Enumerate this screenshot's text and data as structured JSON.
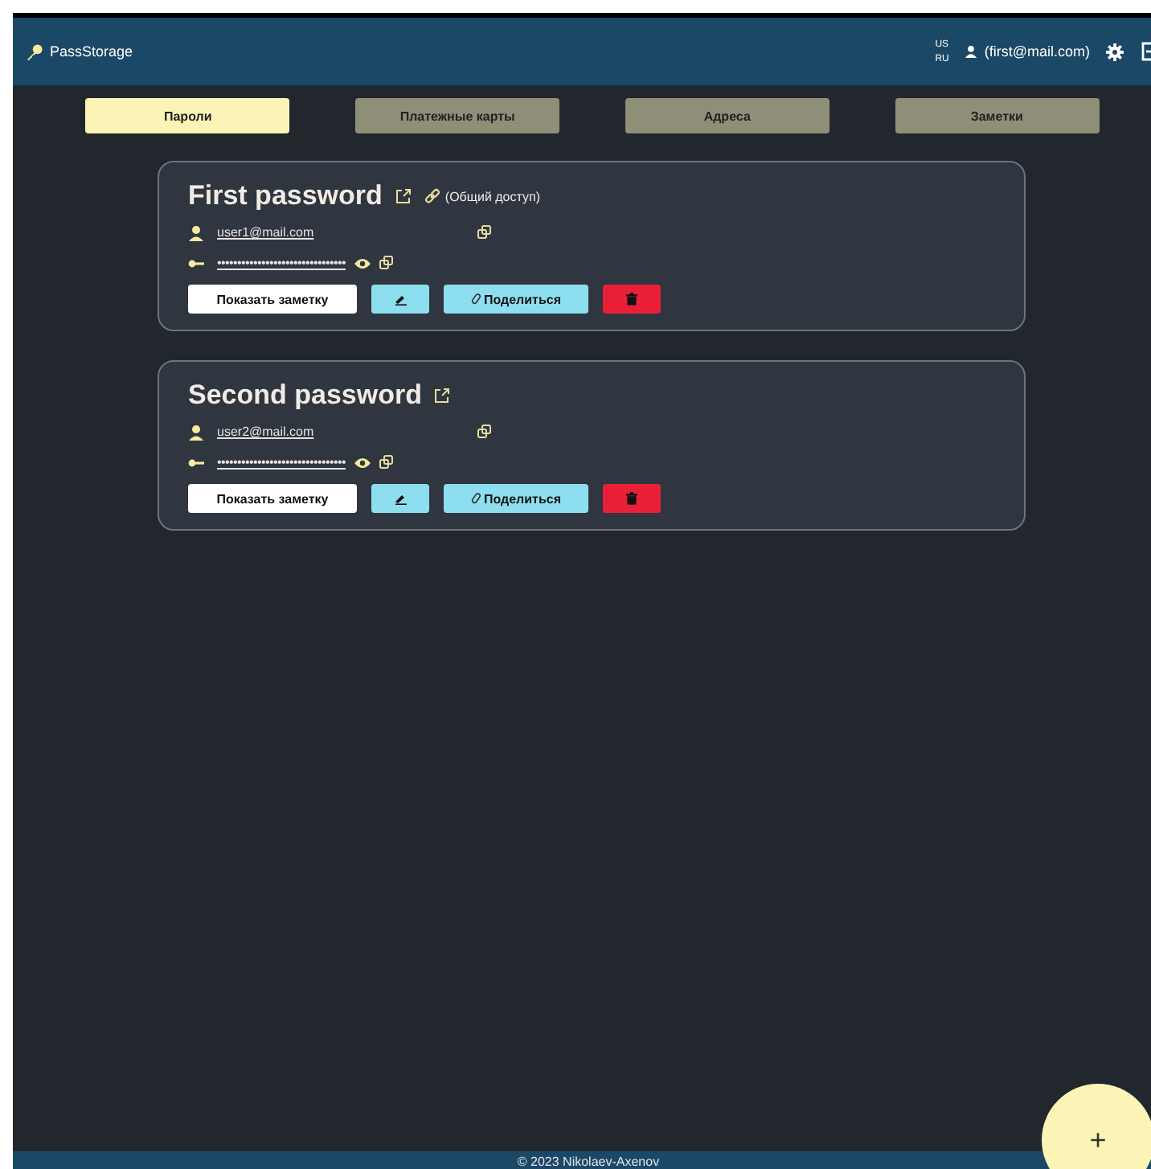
{
  "app": {
    "name": "PassStorage"
  },
  "languages": [
    "US",
    "RU"
  ],
  "user": "(first@mail.com)",
  "tabs": [
    {
      "label": "Пароли",
      "selected": true
    },
    {
      "label": "Платежные карты",
      "selected": false
    },
    {
      "label": "Адреса",
      "selected": false
    },
    {
      "label": "Заметки",
      "selected": false
    }
  ],
  "passwords": [
    {
      "title": "First password",
      "shared": true,
      "shared_label": "(Общий доступ)",
      "login": "user1@mail.com",
      "password_mask": "••••••••••••••••••••••••••••••••",
      "note_button": "Показать заметку",
      "share_button": "Поделиться"
    },
    {
      "title": "Second password",
      "shared": false,
      "login": "user2@mail.com",
      "password_mask": "••••••••••••••••••••••••••••••••",
      "note_button": "Показать заметку",
      "share_button": "Поделиться"
    }
  ],
  "fab": "+",
  "footer": "© 2023 Nikolaev-Axenov"
}
